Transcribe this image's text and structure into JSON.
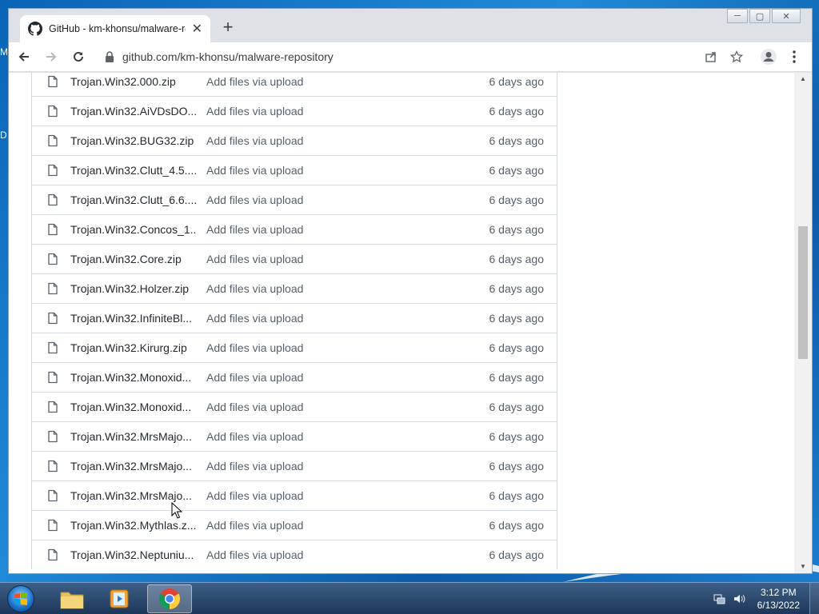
{
  "desktop": {
    "edge_text_top": "M",
    "edge_text_mid": "D"
  },
  "browser": {
    "tab_title": "GitHub - km-khonsu/malware-re",
    "tab_close": "✕",
    "new_tab": "+",
    "url": "github.com/km-khonsu/malware-repository",
    "window_controls": {
      "minimize": "─",
      "maximize": "▢",
      "close": "✕"
    }
  },
  "files": [
    {
      "name": "Trojan.Win32.000.zip",
      "commit": "Add files via upload",
      "age": "6 days ago"
    },
    {
      "name": "Trojan.Win32.AiVDsDO...",
      "commit": "Add files via upload",
      "age": "6 days ago"
    },
    {
      "name": "Trojan.Win32.BUG32.zip",
      "commit": "Add files via upload",
      "age": "6 days ago"
    },
    {
      "name": "Trojan.Win32.Clutt_4.5....",
      "commit": "Add files via upload",
      "age": "6 days ago"
    },
    {
      "name": "Trojan.Win32.Clutt_6.6....",
      "commit": "Add files via upload",
      "age": "6 days ago"
    },
    {
      "name": "Trojan.Win32.Concos_1...",
      "commit": "Add files via upload",
      "age": "6 days ago"
    },
    {
      "name": "Trojan.Win32.Core.zip",
      "commit": "Add files via upload",
      "age": "6 days ago"
    },
    {
      "name": "Trojan.Win32.Holzer.zip",
      "commit": "Add files via upload",
      "age": "6 days ago"
    },
    {
      "name": "Trojan.Win32.InfiniteBl...",
      "commit": "Add files via upload",
      "age": "6 days ago"
    },
    {
      "name": "Trojan.Win32.Kirurg.zip",
      "commit": "Add files via upload",
      "age": "6 days ago"
    },
    {
      "name": "Trojan.Win32.Monoxid...",
      "commit": "Add files via upload",
      "age": "6 days ago"
    },
    {
      "name": "Trojan.Win32.Monoxid...",
      "commit": "Add files via upload",
      "age": "6 days ago"
    },
    {
      "name": "Trojan.Win32.MrsMajo...",
      "commit": "Add files via upload",
      "age": "6 days ago"
    },
    {
      "name": "Trojan.Win32.MrsMajo...",
      "commit": "Add files via upload",
      "age": "6 days ago"
    },
    {
      "name": "Trojan.Win32.MrsMajo...",
      "commit": "Add files via upload",
      "age": "6 days ago"
    },
    {
      "name": "Trojan.Win32.Mythlas.z...",
      "commit": "Add files via upload",
      "age": "6 days ago"
    },
    {
      "name": "Trojan.Win32.Neptuniu...",
      "commit": "Add files via upload",
      "age": "6 days ago"
    }
  ],
  "taskbar": {
    "time": "3:12 PM",
    "date": "6/13/2022"
  }
}
